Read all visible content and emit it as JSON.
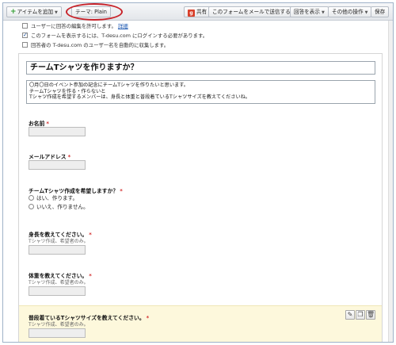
{
  "toolbar": {
    "add_item": "アイテムを追加",
    "theme": "テーマ: Plain",
    "share": "共有",
    "email_form": "このフォームをメールで送信する",
    "view_responses": "回答を表示",
    "more_actions": "その他の操作",
    "save": "保存"
  },
  "settings": {
    "allow_edit": "ユーザーに回答の編集を許可します。",
    "allow_edit_link": "詳細",
    "require_login": "このフォームを表示するには、T-desu.com にログインする必要があります。",
    "collect_username": "回答者の T-desu.com のユーザー名を自動的に収集します。"
  },
  "form": {
    "title": "チームTシャツを作りますか？",
    "description": [
      "〇月〇日のイベント参加の記念にチームTシャツを作りたいと思います。",
      "チームTシャツを作る・作らないと",
      "Tシャツ作成を希望するメンバーは、身長と体重と普段着ているTシャツサイズを教えてくださいね。"
    ],
    "questions": {
      "name": {
        "title": "お名前"
      },
      "email": {
        "title": "メールアドレス"
      },
      "want_tshirt": {
        "title": "チームTシャツ作成を希望しますか？",
        "options": [
          "はい、作ります。",
          "いいえ、作りません。"
        ]
      },
      "height": {
        "title": "身長を教えてください。",
        "help": "Tシャツ作成、希望者のみ。"
      },
      "weight": {
        "title": "体重を教えてください。",
        "help": "Tシャツ作成、希望者のみ。"
      },
      "size": {
        "title": "普段着ているTシャツサイズを教えてください。",
        "help": "Tシャツ作成、希望者のみ。"
      }
    },
    "required_mark": "*"
  },
  "icons": [
    "plus-icon",
    "share-icon",
    "edit-icon",
    "duplicate-icon",
    "delete-icon"
  ]
}
